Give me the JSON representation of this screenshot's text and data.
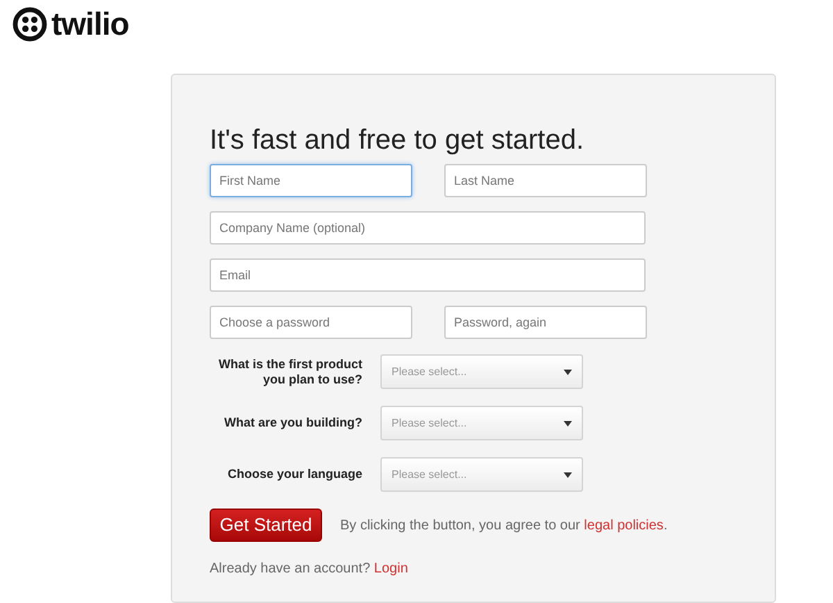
{
  "logo": {
    "wordmark": "twilio"
  },
  "form": {
    "heading": "It's fast and free to get started.",
    "field_rows": [
      [
        {
          "placeholder": "First Name",
          "focused": true
        },
        {
          "placeholder": "Last Name",
          "focused": false
        }
      ],
      [
        {
          "placeholder": "Company Name (optional)",
          "focused": false
        }
      ],
      [
        {
          "placeholder": "Email",
          "focused": false
        }
      ],
      [
        {
          "placeholder": "Choose a password",
          "focused": false
        },
        {
          "placeholder": "Password, again",
          "focused": false
        }
      ]
    ],
    "selects": [
      {
        "label": "What is the first product you plan to use?",
        "placeholder": "Please select..."
      },
      {
        "label": "What are you building?",
        "placeholder": "Please select..."
      },
      {
        "label": "Choose your language",
        "placeholder": "Please select..."
      }
    ],
    "submit": "Get Started",
    "agreement": {
      "text": "By clicking the button, you agree to our",
      "link": "legal policies",
      "after": "."
    },
    "login": {
      "text": "Already have an account?",
      "link": "Login"
    }
  }
}
